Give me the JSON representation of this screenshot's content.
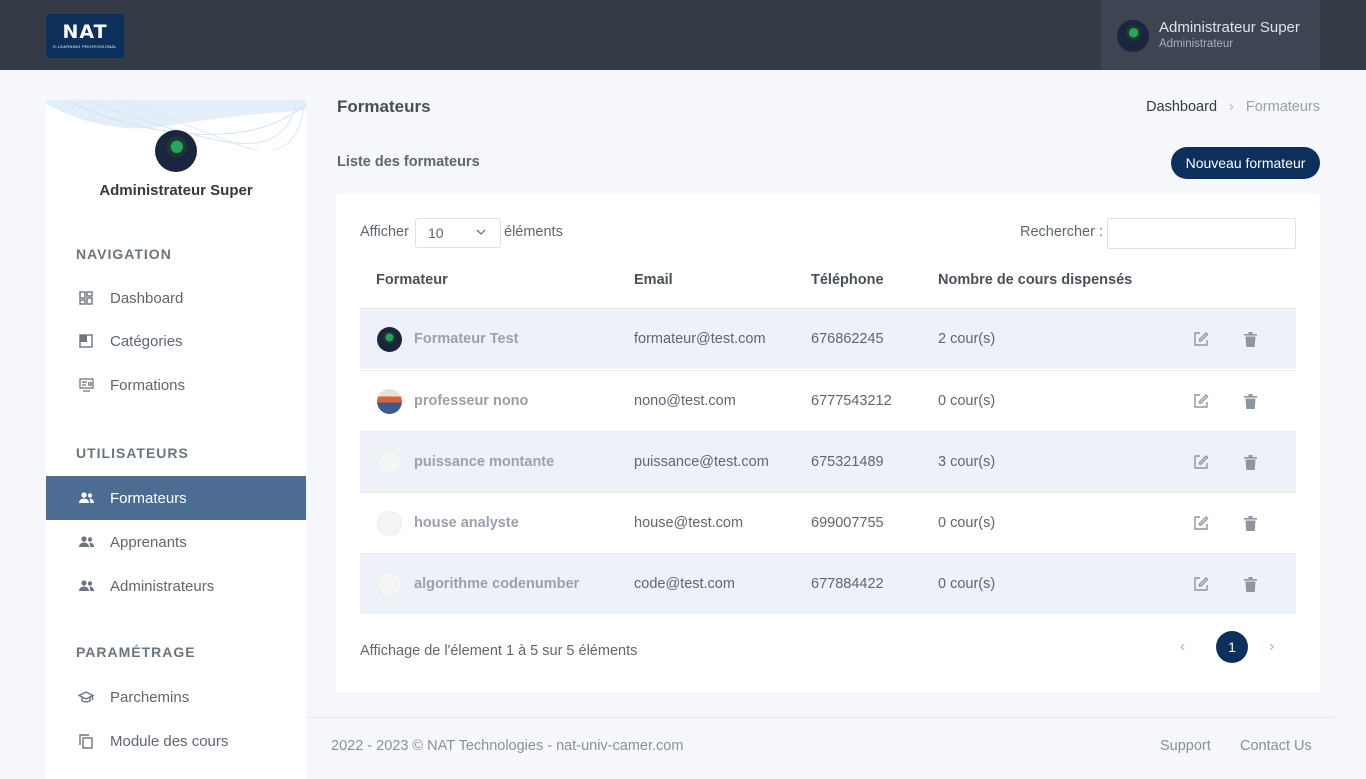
{
  "app": {
    "logo_text": "NAT",
    "logo_subtext": "E-LEARNING PROFESSIONAL"
  },
  "header": {
    "user_name": "Administrateur Super",
    "user_role": "Administrateur"
  },
  "sidebar": {
    "profile_name": "Administrateur Super",
    "sections": [
      {
        "title": "NAVIGATION",
        "items": [
          {
            "label": "Dashboard",
            "icon": "dashboard-icon"
          },
          {
            "label": "Catégories",
            "icon": "category-icon"
          },
          {
            "label": "Formations",
            "icon": "formations-icon"
          }
        ]
      },
      {
        "title": "UTILISATEURS",
        "items": [
          {
            "label": "Formateurs",
            "icon": "users-icon",
            "active": true
          },
          {
            "label": "Apprenants",
            "icon": "users-icon"
          },
          {
            "label": "Administrateurs",
            "icon": "users-icon"
          }
        ]
      },
      {
        "title": "PARAMÉTRAGE",
        "items": [
          {
            "label": "Parchemins",
            "icon": "graduation-cap-icon"
          },
          {
            "label": "Module des cours",
            "icon": "copy-icon"
          }
        ]
      }
    ]
  },
  "page": {
    "title": "Formateurs",
    "breadcrumb": {
      "home": "Dashboard",
      "separator": "›",
      "current": "Formateurs"
    },
    "list_title": "Liste des formateurs",
    "new_button": "Nouveau formateur"
  },
  "table": {
    "show_label": "Afficher",
    "page_size": "10",
    "elements_label": "éléments",
    "search_label": "Rechercher :",
    "columns": [
      "Formateur",
      "Email",
      "Téléphone",
      "Nombre de cours dispensés"
    ],
    "rows": [
      {
        "name": "Formateur Test",
        "email": "formateur@test.com",
        "phone": "676862245",
        "courses": "2 cour(s)"
      },
      {
        "name": "professeur nono",
        "email": "nono@test.com",
        "phone": "6777543212",
        "courses": "0 cour(s)"
      },
      {
        "name": "puissance montante",
        "email": "puissance@test.com",
        "phone": "675321489",
        "courses": "3 cour(s)"
      },
      {
        "name": "house analyste",
        "email": "house@test.com",
        "phone": "699007755",
        "courses": "0 cour(s)"
      },
      {
        "name": "algorithme codenumber",
        "email": "code@test.com",
        "phone": "677884422",
        "courses": "0 cour(s)"
      }
    ],
    "info": "Affichage de l'élement 1 à 5 sur 5 éléments",
    "pagination": {
      "prev": "‹",
      "current": "1",
      "next": "›"
    }
  },
  "footer": {
    "copyright": "2022 - 2023 © NAT Technologies - nat-univ-camer.com",
    "support": "Support",
    "contact": "Contact Us"
  },
  "colors": {
    "brand": "#0c2f5c",
    "topbar": "#343a46",
    "active_nav": "#4c6d91",
    "row_stripe": "#eef1f8"
  }
}
